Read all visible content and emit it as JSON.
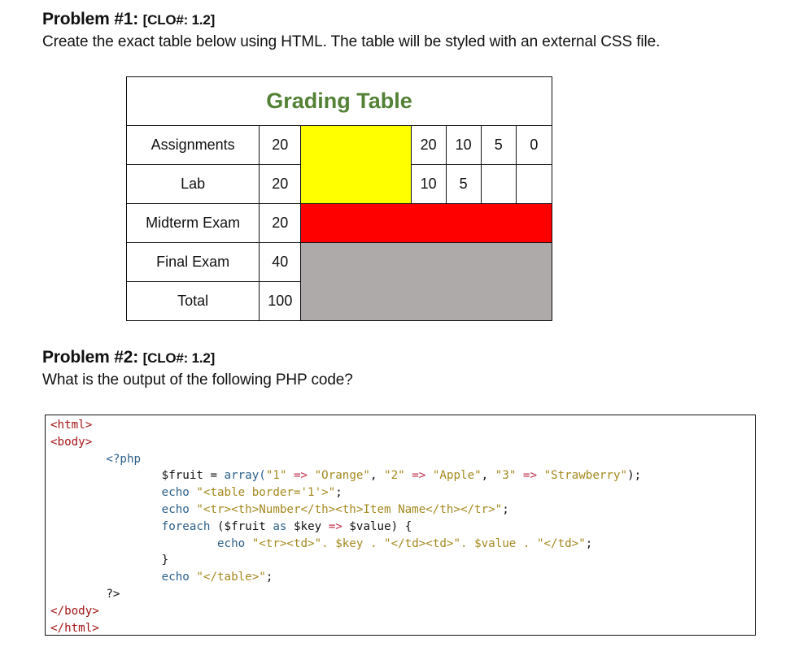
{
  "problem1": {
    "title": "Problem #1:",
    "clo": "[CLO#: 1.2]",
    "description": "Create the exact table below using HTML. The table will be styled with an external CSS file."
  },
  "grading_table": {
    "caption": "Grading Table",
    "caption_color": "#538135",
    "rows": [
      {
        "label": "Assignments",
        "points": "20",
        "scale": [
          "20",
          "10",
          "5",
          "0"
        ]
      },
      {
        "label": "Lab",
        "points": "20",
        "scale": [
          "10",
          "5",
          "",
          ""
        ]
      },
      {
        "label": "Midterm Exam",
        "points": "20"
      },
      {
        "label": "Final Exam",
        "points": "40"
      },
      {
        "label": "Total",
        "points": "100"
      }
    ],
    "colors": {
      "yellow": "#ffff00",
      "red": "#ff0000",
      "gray": "#aeaaaa"
    }
  },
  "problem2": {
    "title": "Problem #2:",
    "clo": "[CLO#: 1.2]",
    "description": "What is the output of the following PHP code?"
  },
  "code": {
    "html_open": "<html>",
    "body_open": "<body>",
    "php_open": "<?php",
    "line_fruit_var": "$fruit",
    "line_fruit_eq": " = ",
    "line_fruit_array": "array(",
    "k1": "\"1\"",
    "v1": "\"Orange\"",
    "k2": "\"2\"",
    "v2": "\"Apple\"",
    "k3": "\"3\"",
    "v3": "\"Strawberry\"",
    "arrow": "=>",
    "echo": "echo",
    "echo_table": "\"<table border='1'>\"",
    "echo_header": "\"<tr><th>Number</th><th>Item Name</th></tr>\"",
    "foreach": "foreach",
    "foreach_src": "($fruit",
    "as": "as",
    "key_var": "$key",
    "value_var": "$value) {",
    "row_open": "\"<tr><td>\"",
    "row_key": "$key",
    "row_mid": "\"</td><td>\"",
    "row_value": "$value",
    "row_close": "\"</td>\"",
    "close_brace": "}",
    "echo_table_close": "\"</table>\"",
    "php_close": "?>",
    "body_close": "</body>",
    "html_close": "</html>"
  }
}
